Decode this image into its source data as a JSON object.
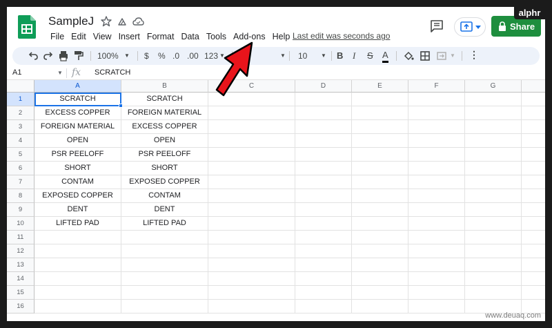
{
  "app": {
    "doc_title": "SampleJ",
    "menu": [
      "File",
      "Edit",
      "View",
      "Insert",
      "Format",
      "Data",
      "Tools",
      "Add-ons",
      "Help"
    ],
    "last_edit": "Last edit was seconds ago",
    "share_label": "Share",
    "brand_color": "#1e8e3e",
    "selection_color": "#1a73e8"
  },
  "toolbar": {
    "zoom": "100%",
    "currency": "$",
    "percent": "%",
    "dec_less": ".0",
    "dec_more": ".00",
    "more_formats": "123",
    "font_size": "10",
    "bold": "B",
    "italic": "I",
    "strike": "S",
    "text_color": "A",
    "more": "⋮"
  },
  "formula_bar": {
    "cell_ref": "A1",
    "fx": "fx",
    "value": "SCRATCH"
  },
  "grid": {
    "columns": [
      "A",
      "B",
      "C",
      "D",
      "E",
      "F",
      "G"
    ],
    "rows": [
      "1",
      "2",
      "3",
      "4",
      "5",
      "6",
      "7",
      "8",
      "9",
      "10",
      "11",
      "12",
      "13",
      "14",
      "15",
      "16"
    ],
    "col_a": [
      "SCRATCH",
      "EXCESS COPPER",
      "FOREIGN MATERIAL",
      "OPEN",
      "PSR PEELOFF",
      "SHORT",
      "CONTAM",
      "EXPOSED COPPER",
      "DENT",
      "LIFTED PAD"
    ],
    "col_b": [
      "SCRATCH",
      "FOREIGN MATERIAL",
      "EXCESS COPPER",
      "OPEN",
      "PSR PEELOFF",
      "SHORT",
      "EXPOSED COPPER",
      "CONTAM",
      "DENT",
      "LIFTED PAD"
    ]
  },
  "watermarks": {
    "top_right": "alphr",
    "bottom_right": "www.deuaq.com"
  }
}
